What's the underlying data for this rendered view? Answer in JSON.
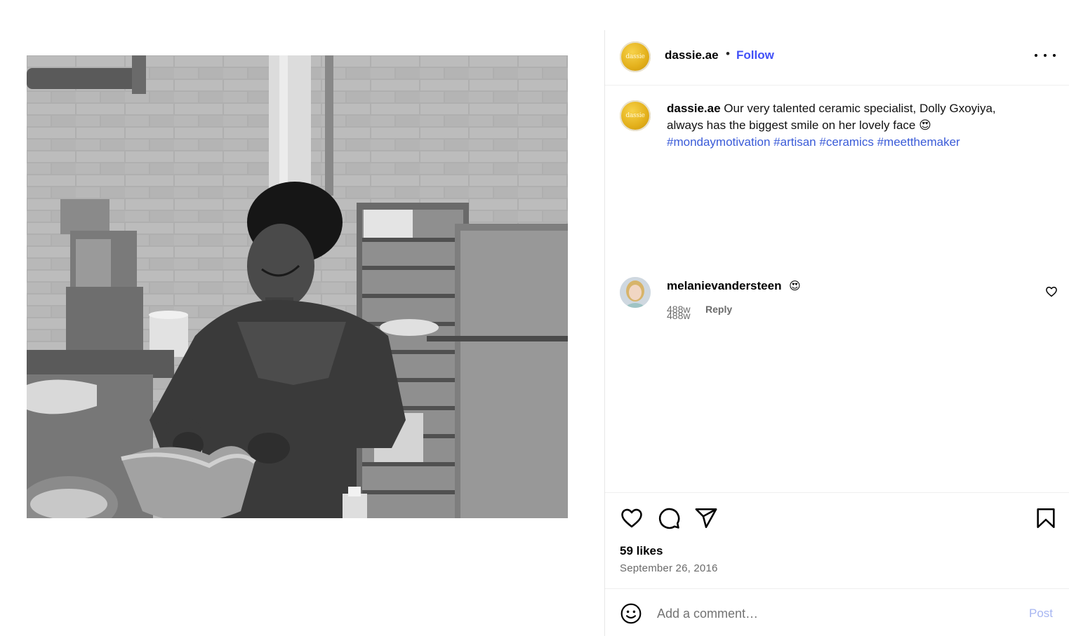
{
  "post": {
    "author": "dassie.ae",
    "avatar_text": "dassie",
    "separator": "•",
    "follow_label": "Follow",
    "more_icon": "more-horizontal-icon",
    "image_alt": "Black and white photo of a smiling ceramic specialist shaping clay in a pottery workshop"
  },
  "caption": {
    "username": "dassie.ae",
    "text": " Our very talented ceramic specialist, Dolly Gxoyiya, always has the biggest smile on her lovely face ",
    "emoji": "😍",
    "hashtags": [
      "#mondaymotivation",
      "#artisan",
      "#ceramics",
      "#meetthemaker"
    ],
    "time": "488w"
  },
  "comments": [
    {
      "username": "melanievandersteen",
      "emoji": "😍",
      "time": "488w",
      "reply_label": "Reply"
    }
  ],
  "actions": {
    "icons": [
      "heart-icon",
      "comment-icon",
      "share-icon",
      "bookmark-icon"
    ],
    "likes": "59 likes",
    "date": "September 26, 2016"
  },
  "comment_box": {
    "placeholder": "Add a comment…",
    "post_label": "Post"
  },
  "colors": {
    "link_blue": "#4150f7",
    "hashtag_blue": "#3a5bd8",
    "post_disabled": "#a7b6f2",
    "muted": "#6b6b6b"
  }
}
